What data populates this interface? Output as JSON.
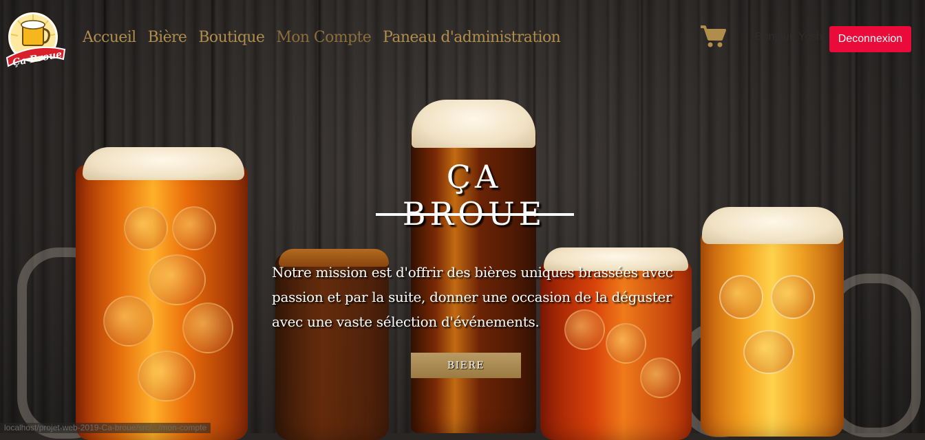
{
  "brand": {
    "logo_text": "Ça Broue"
  },
  "nav": {
    "items": [
      {
        "label": "Accueil",
        "active": false
      },
      {
        "label": "Bière",
        "active": false
      },
      {
        "label": "Boutique",
        "active": false
      },
      {
        "label": "Mon Compte",
        "active": true
      },
      {
        "label": "Paneau d'administration",
        "active": false
      }
    ]
  },
  "header": {
    "cart_icon": "cart-icon",
    "greeting": "Bonjour, Yoshi",
    "logout_label": "Deconnexion"
  },
  "hero": {
    "title": "ÇA BROUE",
    "text": "Notre mission est d'offrir des bières uniques brassées avec passion et par la suite, donner une occasion de la déguster avec une vaste sélection d'événements.",
    "button_label": "BIERE"
  },
  "status_bar": {
    "url": "localhost/projet-web-2019-Ca-broue/src/.../mon-compte"
  },
  "colors": {
    "accent_gold": "#b18d4c",
    "logout_red": "#ea0b3a"
  }
}
